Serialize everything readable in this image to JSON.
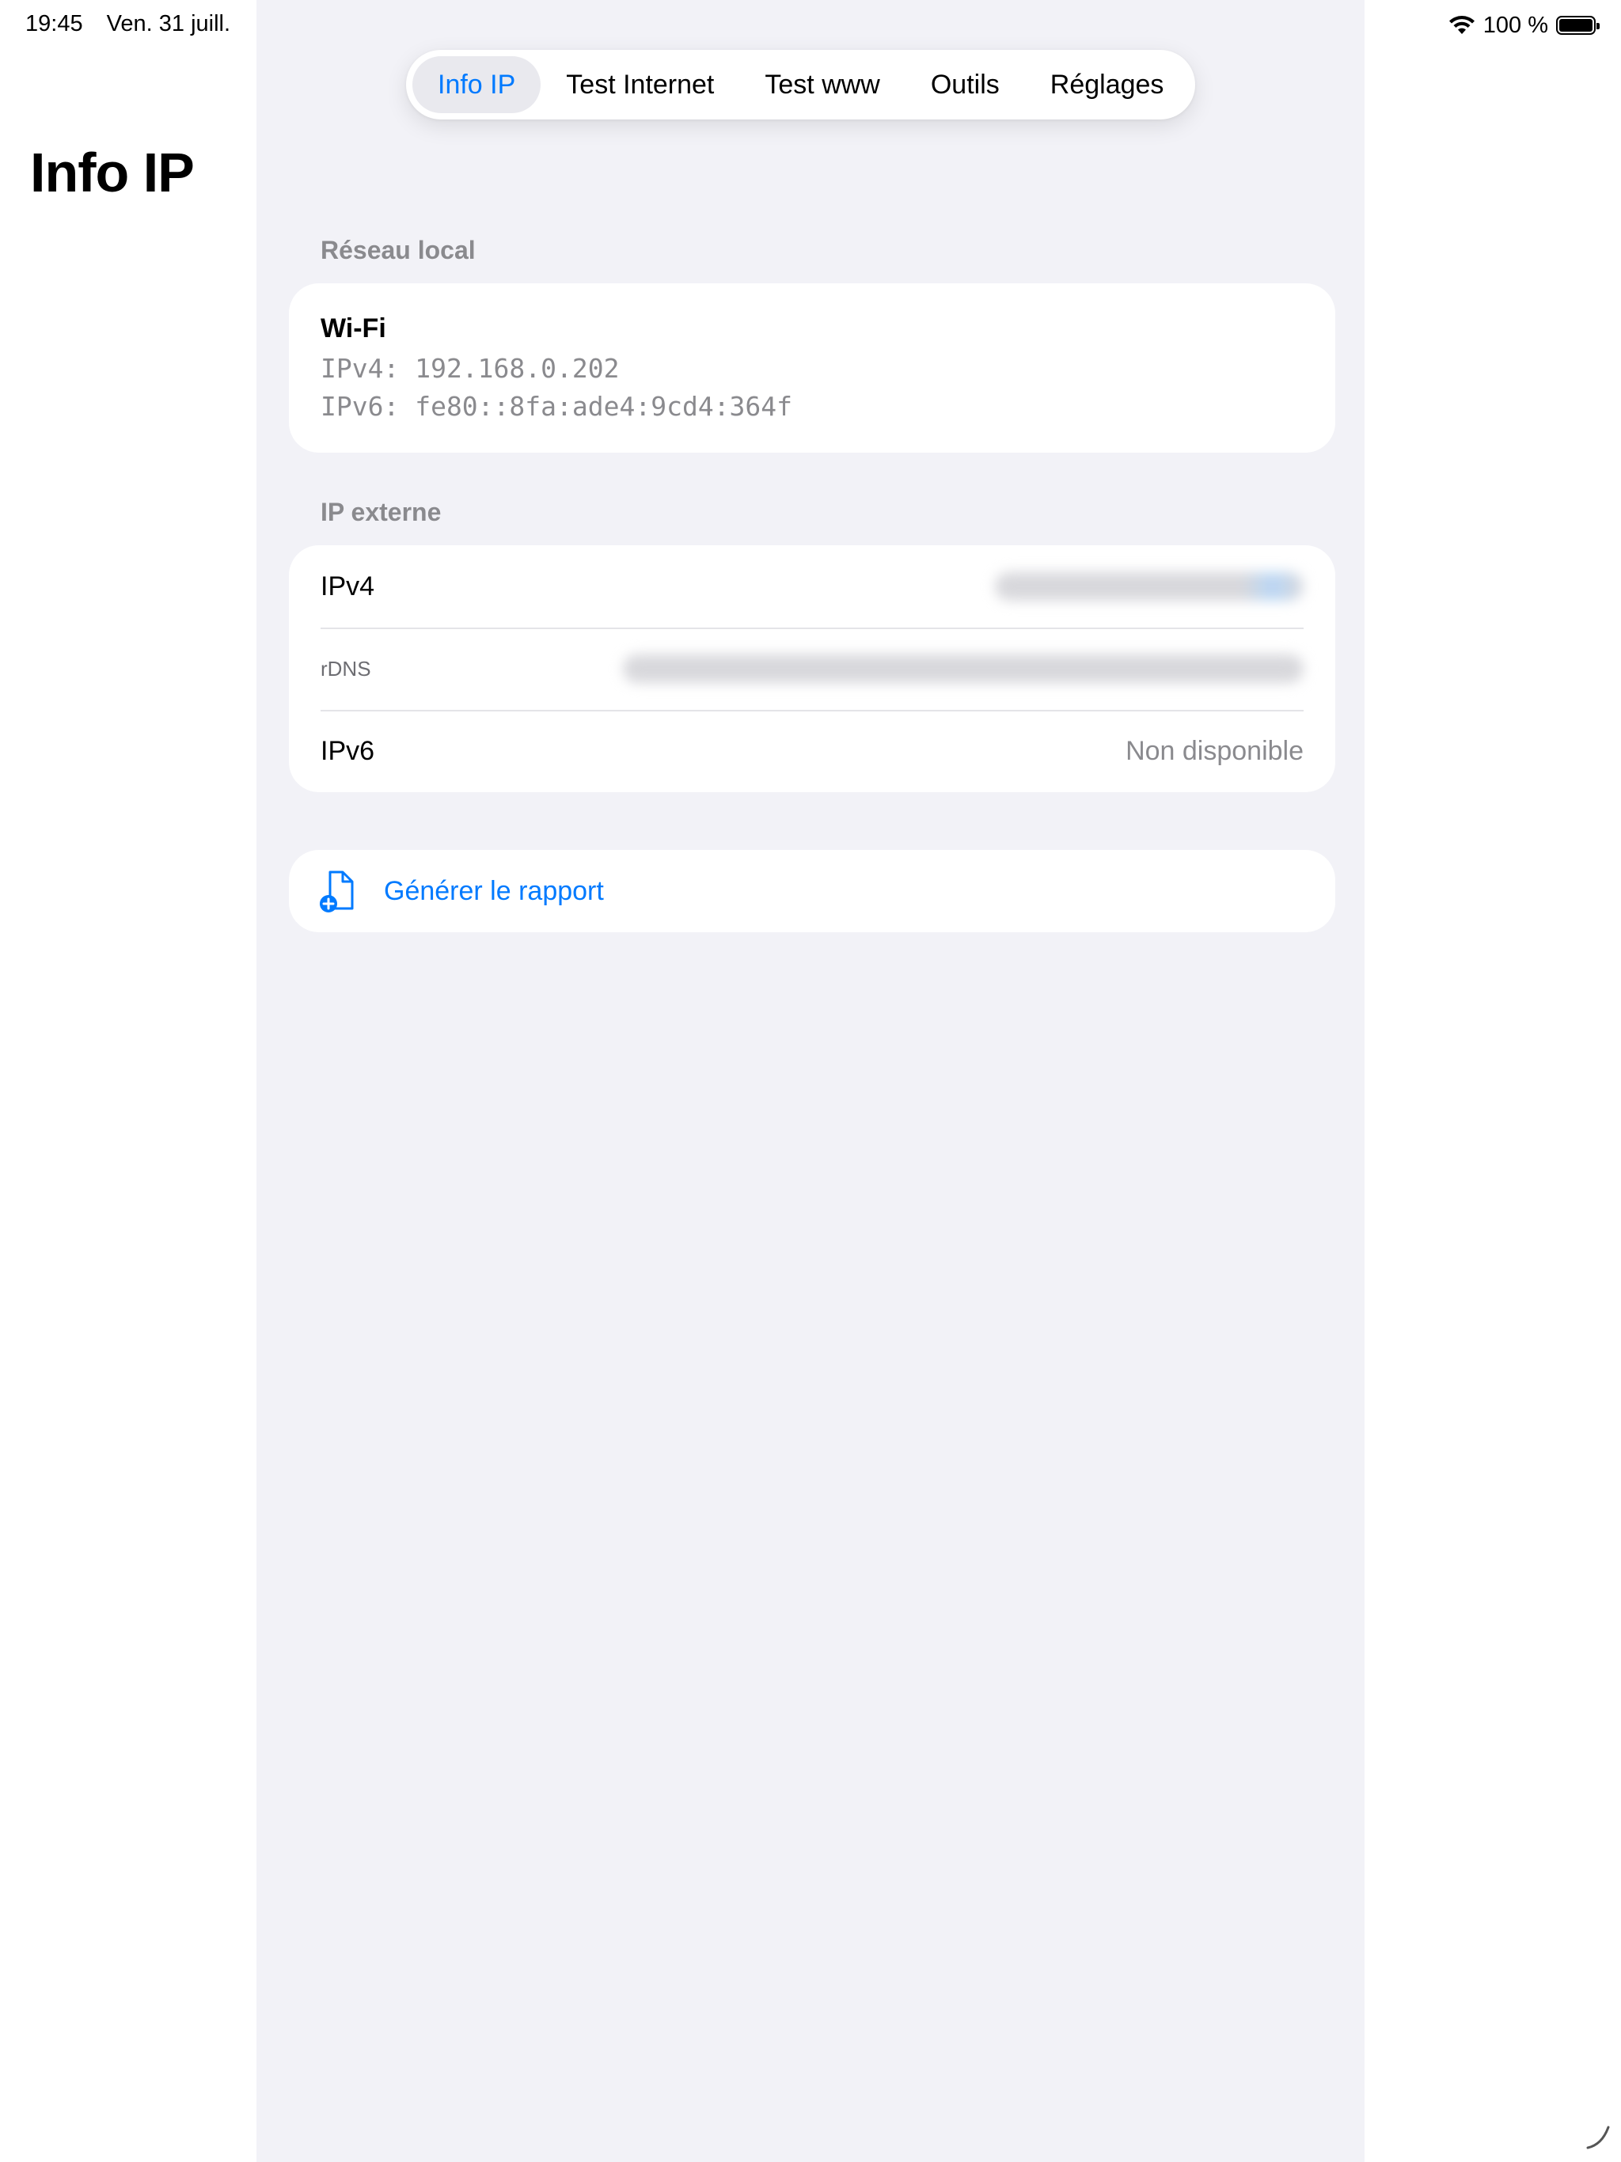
{
  "status_bar": {
    "time": "19:45",
    "date": "Ven. 31 juill.",
    "battery_text": "100 %",
    "wifi_icon": "wifi-icon",
    "battery_icon": "battery-full-icon"
  },
  "sidebar": {
    "title": "Info IP"
  },
  "tabs": [
    {
      "label": "Info IP",
      "active": true
    },
    {
      "label": "Test Internet",
      "active": false
    },
    {
      "label": "Test www",
      "active": false
    },
    {
      "label": "Outils",
      "active": false
    },
    {
      "label": "Réglages",
      "active": false
    }
  ],
  "local_network": {
    "section_label": "Réseau local",
    "interface": "Wi-Fi",
    "ipv4": "IPv4: 192.168.0.202",
    "ipv6": "IPv6: fe80::8fa:ade4:9cd4:364f"
  },
  "external_ip": {
    "section_label": "IP externe",
    "rows": [
      {
        "label": "IPv4",
        "value_redacted": true
      },
      {
        "label": "rDNS",
        "value_redacted": true
      },
      {
        "label": "IPv6",
        "value": "Non disponible"
      }
    ]
  },
  "report": {
    "label": "Générer le rapport",
    "icon": "document-add-icon"
  },
  "colors": {
    "accent": "#007aff",
    "background": "#f2f2f7",
    "secondary_text": "#8a8a8e"
  }
}
